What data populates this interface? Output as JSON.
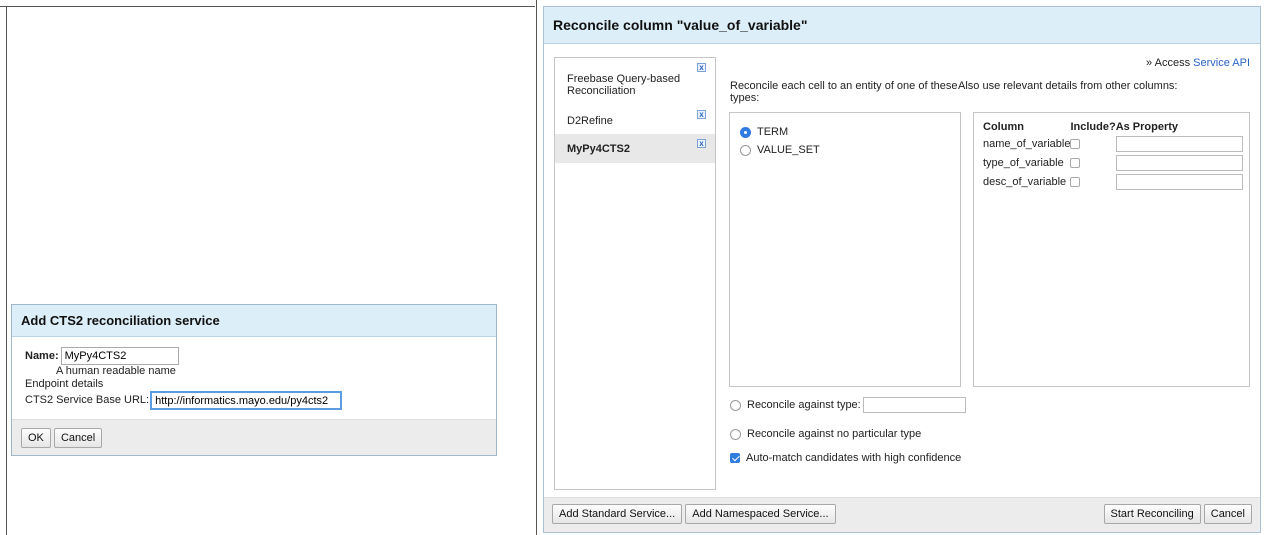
{
  "cts2_dialog": {
    "title": "Add CTS2 reconciliation service",
    "name_label": "Name:",
    "name_value": "MyPy4CTS2",
    "name_hint": "A human readable name",
    "endpoint_label": "Endpoint details",
    "url_label": "CTS2 Service Base URL:",
    "url_value": "http://informatics.mayo.edu/py4cts2",
    "ok_label": "OK",
    "cancel_label": "Cancel"
  },
  "reconcile_dialog": {
    "title": "Reconcile column \"value_of_variable\"",
    "access_prefix": "» Access",
    "access_link": "Service API",
    "services": [
      {
        "label": "Freebase Query-based Reconciliation",
        "close": "x"
      },
      {
        "label": "D2Refine",
        "close": "x"
      },
      {
        "label": "MyPy4CTS2",
        "close": "x"
      }
    ],
    "types_label": "Reconcile each cell to an entity of one of these types:",
    "types": [
      {
        "label": "TERM",
        "selected": true
      },
      {
        "label": "VALUE_SET",
        "selected": false
      }
    ],
    "other_columns_label": "Also use relevant details from other columns:",
    "columns_header": {
      "column": "Column",
      "include": "Include?",
      "property": "As Property"
    },
    "columns": [
      {
        "name": "name_of_variable"
      },
      {
        "name": "type_of_variable"
      },
      {
        "name": "desc_of_variable"
      }
    ],
    "against_type_label": "Reconcile against type:",
    "against_none_label": "Reconcile against no particular type",
    "automatch_label": "Auto-match candidates with high confidence",
    "add_standard_label": "Add Standard Service...",
    "add_namespaced_label": "Add Namespaced Service...",
    "start_label": "Start Reconciling",
    "cancel_label": "Cancel"
  },
  "colors": {
    "header_bg": "#dceef8",
    "accent": "#2f7be0",
    "link": "#2a63c6"
  }
}
